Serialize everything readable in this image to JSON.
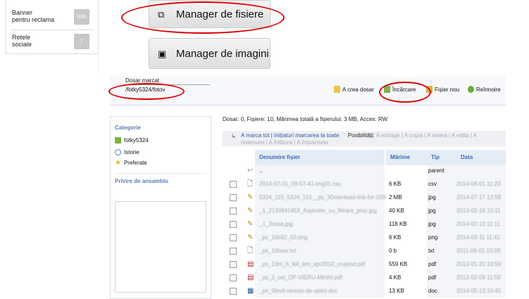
{
  "left_panel": {
    "banner": {
      "label": "Banner\npentru reclama",
      "icon": "banner-icon",
      "icon_text": "Info"
    },
    "social": {
      "label": "Retele\nsociale",
      "icon": "social-icon",
      "icon_text": "f"
    }
  },
  "buttons": {
    "file_manager": "Manager de fisiere",
    "image_manager": "Manager de imagini"
  },
  "toolbar": {
    "folder_label": "Dosar marcat",
    "folder_path": "/fotky5324/fotov",
    "create_folder": "A crea dosar",
    "upload": "Încărcare",
    "new_file": "Fișier nou",
    "refresh": "Reînnoire"
  },
  "sidebar": {
    "category_title": "Categorie",
    "items": [
      {
        "label": "fotky5324",
        "icon": "folder-icon"
      },
      {
        "label": "Istorie",
        "icon": "clock-icon"
      },
      {
        "label": "Preferate",
        "icon": "star-icon"
      }
    ],
    "overview_title": "Privire de ansamblu"
  },
  "info": "Dosar: 0, Fișiere: 10, Mărimea totală a fișierului: 3 MB, Acces: RW",
  "actions": {
    "mark_all": "A marca tot",
    "separator": " | ",
    "start_marking": "Inițiaturi marcarea la toate",
    "possibilities": "Posibilități:",
    "extract": "A extrage",
    "copy": "A copia",
    "insert": "A insera",
    "edit": "A edita",
    "rename": "redenumi",
    "delete": "A înlătura",
    "zip": "A împacheta"
  },
  "table": {
    "headers": {
      "name": "Denumire fișier",
      "size": "Mărime",
      "type": "Tip",
      "date": "Data"
    },
    "parent": {
      "name": "..",
      "type": "parent"
    },
    "rows": [
      {
        "name": "2014-07-31_09-57-41-img01.csv",
        "size": "6 KB",
        "type": "csv",
        "date": "2014-08-01 11:23",
        "icon": "text-file-icon"
      },
      {
        "name": "5324_115_5324_110__ps_3Download-link-for-1000021 - Pigeons-flying.jpg",
        "size": "2 MB",
        "type": "jpg",
        "date": "2014-07-17 12:58",
        "icon": "image-file-icon"
      },
      {
        "name": "_1_2130841853_Aspirator_cu_filtrare_proc.jpg",
        "size": "40 KB",
        "type": "jpg",
        "date": "2013-02-16 15:11",
        "icon": "image-file-icon"
      },
      {
        "name": "_1_3casa.jpg",
        "size": "118 KB",
        "type": "jpg",
        "date": "2014-02-13 11:11",
        "icon": "image-file-icon"
      },
      {
        "name": "_ps_10b82_03.png",
        "size": "6 KB",
        "type": "png",
        "date": "2014-03-11 11:41",
        "icon": "image-file-icon"
      },
      {
        "name": "_ps_10bxer.txt",
        "size": "0 b",
        "type": "txt",
        "date": "2011-08-01 10:09",
        "icon": "text-file-icon"
      },
      {
        "name": "_ps_13m_b_fell_brn_apr2010_crupind.pdf",
        "size": "559 KB",
        "type": "pdf",
        "date": "2012-01-20 10:59",
        "icon": "pdf-file-icon"
      },
      {
        "name": "_ps_3_ost_DP-VIERU-MIHAI.pdf",
        "size": "4 KB",
        "type": "pdf",
        "date": "2012-02-09 11:59",
        "icon": "pdf-file-icon"
      },
      {
        "name": "_ps_5fev6-revista-de-optici.doc",
        "size": "13 KB",
        "type": "doc",
        "date": "2014-05-13 10:45",
        "icon": "doc-file-icon"
      }
    ]
  },
  "colors": {
    "accent": "#3a6db3",
    "annotation": "#dd0000",
    "header_bg": "#e4ecf5"
  }
}
